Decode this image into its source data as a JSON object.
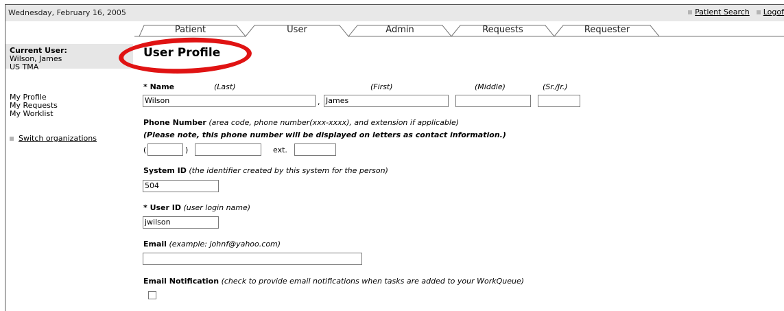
{
  "header": {
    "date": "Wednesday, February 16, 2005",
    "links": [
      "Patient Search",
      "Logof"
    ]
  },
  "tabs": [
    {
      "label": "Patient"
    },
    {
      "label": "User"
    },
    {
      "label": "Admin"
    },
    {
      "label": "Requests"
    },
    {
      "label": "Requester"
    }
  ],
  "sidebar": {
    "current_user_label": "Current User:",
    "user_name": "Wilson, James",
    "org": "US TMA",
    "nav": [
      "My Profile",
      "My Requests",
      "My Worklist"
    ],
    "switch_org": "Switch organizations"
  },
  "page": {
    "title": "User Profile",
    "name": {
      "label": "* Name",
      "last_hint": "(Last)",
      "first_hint": "(First)",
      "middle_hint": "(Middle)",
      "suffix_hint": "(Sr./Jr.)",
      "last_value": "Wilson",
      "comma": ",",
      "first_value": "James",
      "middle_value": "",
      "suffix_value": ""
    },
    "phone": {
      "label": "Phone Number",
      "hint": "(area code, phone number(xxx-xxxx), and extension if applicable)",
      "note": "(Please note, this phone number will be displayed on letters as contact information.)",
      "open_paren": "(",
      "close_paren": ")",
      "ext_label": "ext.",
      "area": "",
      "number": "",
      "ext": ""
    },
    "system_id": {
      "label": "System ID",
      "hint": "(the identifier created by this system for the person)",
      "value": "504"
    },
    "user_id": {
      "label": "* User ID",
      "hint": "(user login name)",
      "value": "jwilson"
    },
    "email": {
      "label": "Email",
      "hint": "(example: johnf@yahoo.com)",
      "value": ""
    },
    "email_notification": {
      "label": "Email Notification",
      "hint": "(check to provide email notifications when tasks are added to your WorkQueue)",
      "checked": false
    }
  }
}
